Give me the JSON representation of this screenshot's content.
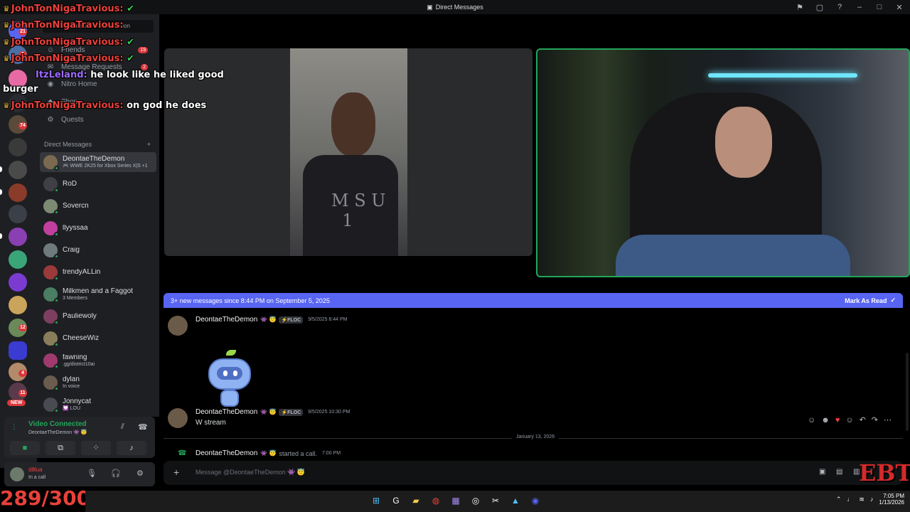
{
  "window": {
    "title": "Direct Messages",
    "controls": [
      "inbox-icon",
      "screen-icon",
      "help-icon",
      "minimize-icon",
      "maximize-icon",
      "close-icon"
    ]
  },
  "rail": {
    "badges": [
      "21",
      "1",
      "74",
      "12",
      "4",
      "11"
    ],
    "new_label": "NEW"
  },
  "sidebar": {
    "search_placeholder": "Find or start a conversation",
    "nav": [
      {
        "label": "Friends",
        "icon": "friends-icon",
        "badge": "19"
      },
      {
        "label": "Message Requests",
        "icon": "envelope-icon",
        "badge": "2"
      },
      {
        "label": "Nitro Home",
        "icon": "nitro-icon"
      },
      {
        "label": "Shop",
        "icon": "shop-icon"
      },
      {
        "label": "Quests",
        "icon": "quests-icon"
      }
    ],
    "dm_header": "Direct Messages",
    "dm_add": "+",
    "dms": [
      {
        "name": "DeontaeTheDemon",
        "status": "🎮 WWE 2K25 for Xbox Series X|S +1",
        "color": "#7a6a52",
        "active": true
      },
      {
        "name": "RoD",
        "status": "",
        "color": "#3f3f46"
      },
      {
        "name": "Sovercn",
        "status": "",
        "color": "#7c8a73"
      },
      {
        "name": "llyyssaa",
        "status": "",
        "color": "#c13f9e"
      },
      {
        "name": "Craig",
        "status": "",
        "color": "#6f7a7c"
      },
      {
        "name": "trendyALLin",
        "status": "",
        "color": "#9b3a3a"
      },
      {
        "name": "Milkmen and a Faggot",
        "status": "3 Members",
        "color": "#4b7d63"
      },
      {
        "name": "Pauliewoly",
        "status": "",
        "color": "#7d3e5f"
      },
      {
        "name": "CheeseWiz",
        "status": "",
        "color": "#8a7e5a"
      },
      {
        "name": "fawning",
        "status": ".gg/district10ai",
        "color": "#a03a6e"
      },
      {
        "name": "dylan",
        "status": "In voice",
        "color": "#6a5c4e"
      },
      {
        "name": "Jonnycat",
        "status": "💟 LOU",
        "color": "#4a4a52"
      }
    ]
  },
  "voice": {
    "title": "Video Connected",
    "subtitle": "DeontaeTheDemon 👾 😇",
    "buttons": [
      "camera-icon",
      "screenshare-icon",
      "activities-icon",
      "soundboard-icon"
    ]
  },
  "user": {
    "name": "d8lua",
    "status": "In a call"
  },
  "banner": {
    "text": "3+ new messages since 8:44 PM on September 5, 2025",
    "action": "Mark As Read"
  },
  "messages": [
    {
      "author": "DeontaeTheDemon",
      "emojis": "👾 😇",
      "tag": "⚡FLOC",
      "time": "9/5/2025 8:44 PM",
      "text": ""
    },
    {
      "author": "DeontaeTheDemon",
      "emojis": "👾 😇",
      "tag": "⚡FLOC",
      "time": "9/5/2025 10:30 PM",
      "text": "W stream"
    }
  ],
  "date_divider": "January 13, 2026",
  "call_event": {
    "author": "DeontaeTheDemon",
    "emojis": "👾 😇",
    "text": "started a call.",
    "time": "7:00 PM"
  },
  "composer": {
    "placeholder": "Message @DeontaeTheDemon 👾 😇"
  },
  "overlay": [
    {
      "user": "JohnTonNigaTravious:",
      "text": "",
      "check": true
    },
    {
      "user": "JohnTonNigaTravious:",
      "text": "",
      "check": false
    },
    {
      "user": "JohnTonNigaTravious:",
      "text": "",
      "check": true
    },
    {
      "user": "JohnTonNigaTravious:",
      "text": "",
      "check": true
    },
    {
      "user": "ItzLeland:",
      "text": "he look like he liked good",
      "check": false
    },
    {
      "user": "",
      "text": "burger",
      "check": false
    },
    {
      "user": "JohnTonNigaTravious:",
      "text": "on god he does",
      "check": false
    }
  ],
  "counter": "289/300",
  "logo": "EBT",
  "taskbar": {
    "time": "7:05 PM",
    "date": "1/13/2026"
  }
}
